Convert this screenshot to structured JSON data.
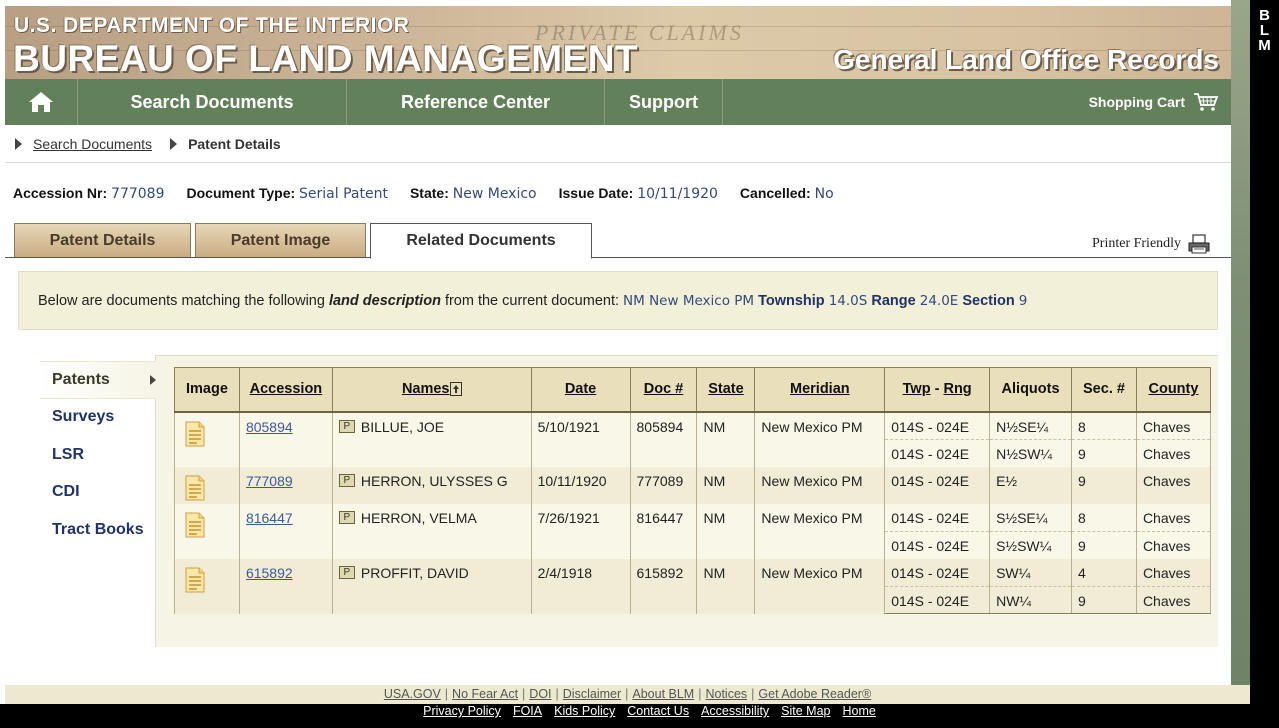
{
  "side_label": "BLM",
  "banner": {
    "dept": "U.S. DEPARTMENT OF THE INTERIOR",
    "bureau": "BUREAU OF LAND MANAGEMENT",
    "title": "General Land Office Records",
    "faint_text": "PRIVATE CLAIMS"
  },
  "nav": {
    "home_icon": "home-icon",
    "items": [
      "Search Documents",
      "Reference Center",
      "Support"
    ],
    "cart_label": "Shopping Cart",
    "cart_icon": "cart-icon"
  },
  "breadcrumb": {
    "link": "Search Documents",
    "current": "Patent Details"
  },
  "meta": {
    "accession_label": "Accession Nr:",
    "accession_value": "777089",
    "doctype_label": "Document Type:",
    "doctype_value": "Serial Patent",
    "state_label": "State:",
    "state_value": "New Mexico",
    "issue_label": "Issue Date:",
    "issue_value": "10/11/1920",
    "cancelled_label": "Cancelled:",
    "cancelled_value": "No"
  },
  "tabs": [
    "Patent Details",
    "Patent Image",
    "Related Documents"
  ],
  "active_tab": "Related Documents",
  "printer_label": "Printer Friendly",
  "description": {
    "prefix": "Below are documents matching the following",
    "emph": "land description",
    "middle": "from the current document:",
    "state": "NM New Mexico PM",
    "township_label": "Township",
    "township_value": "14.0S",
    "range_label": "Range",
    "range_value": "24.0E",
    "section_label": "Section",
    "section_value": "9"
  },
  "left_nav": [
    "Patents",
    "Surveys",
    "LSR",
    "CDI",
    "Tract Books"
  ],
  "table": {
    "headers": {
      "image": "Image",
      "accession": "Accession",
      "names": "Names",
      "date": "Date",
      "doc": "Doc #",
      "state": "State",
      "meridian": "Meridian",
      "twp": "Twp",
      "dash": "-",
      "rng": "Rng",
      "aliquots": "Aliquots",
      "sec": "Sec. #",
      "county": "County"
    },
    "pbox": "P",
    "rows": [
      {
        "accession": "805894",
        "name": "BILLUE, JOE",
        "date": "5/10/1921",
        "doc": "805894",
        "state": "NM",
        "meridian": "New Mexico PM",
        "lands": [
          {
            "twp": "014S - 024E",
            "aliquot": "N½SE¼",
            "sec": "8",
            "county": "Chaves"
          },
          {
            "twp": "014S - 024E",
            "aliquot": "N½SW¼",
            "sec": "9",
            "county": "Chaves"
          }
        ]
      },
      {
        "accession": "777089",
        "name": "HERRON, ULYSSES G",
        "date": "10/11/1920",
        "doc": "777089",
        "state": "NM",
        "meridian": "New Mexico PM",
        "lands": [
          {
            "twp": "014S - 024E",
            "aliquot": "E½",
            "sec": "9",
            "county": "Chaves"
          }
        ]
      },
      {
        "accession": "816447",
        "name": "HERRON, VELMA",
        "date": "7/26/1921",
        "doc": "816447",
        "state": "NM",
        "meridian": "New Mexico PM",
        "lands": [
          {
            "twp": "014S - 024E",
            "aliquot": "S½SE¼",
            "sec": "8",
            "county": "Chaves"
          },
          {
            "twp": "014S - 024E",
            "aliquot": "S½SW¼",
            "sec": "9",
            "county": "Chaves"
          }
        ]
      },
      {
        "accession": "615892",
        "name": "PROFFIT, DAVID",
        "date": "2/4/1918",
        "doc": "615892",
        "state": "NM",
        "meridian": "New Mexico PM",
        "lands": [
          {
            "twp": "014S - 024E",
            "aliquot": "SW¼",
            "sec": "4",
            "county": "Chaves"
          },
          {
            "twp": "014S - 024E",
            "aliquot": "NW¼",
            "sec": "9",
            "county": "Chaves"
          }
        ]
      }
    ]
  },
  "footer": {
    "row1": [
      "USA.GOV",
      "No Fear Act",
      "DOI",
      "Disclaimer",
      "About BLM",
      "Notices",
      "Get Adobe Reader®"
    ],
    "sep": "|",
    "row2": [
      "Privacy Policy",
      "FOIA",
      "Kids Policy",
      "Contact Us",
      "Accessibility",
      "Site Map",
      "Home"
    ]
  }
}
